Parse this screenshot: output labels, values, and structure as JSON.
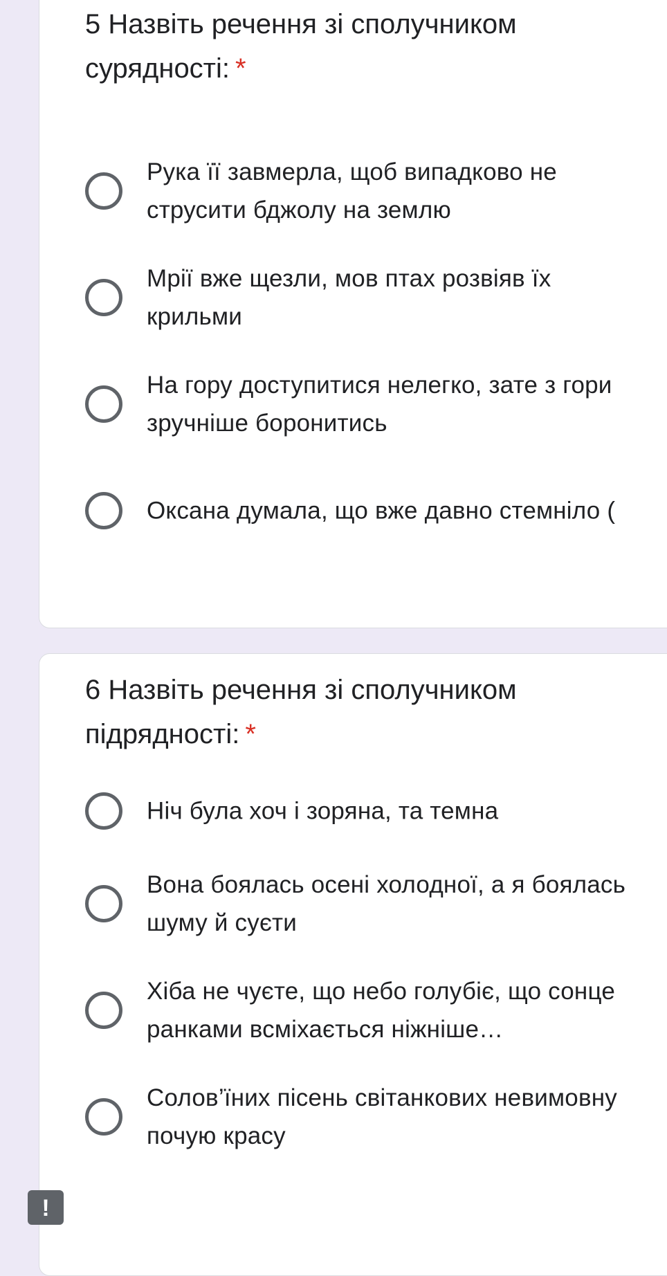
{
  "questions": [
    {
      "title": "5 Назвіть речення зі сполучником сурядності:",
      "required_mark": "*",
      "options": [
        "Рука її завмерла, щоб випадково не струсити бджолу на землю",
        "Мрії вже щезли, мов птах розвіяв їх крильми",
        "На гору доступитися нелегко, зате з гори зручніше боронитись",
        "Оксана думала, що вже давно стемніло ("
      ]
    },
    {
      "title": "6 Назвіть речення зі сполучником підрядності:",
      "required_mark": "*",
      "options": [
        "Ніч була хоч і зоряна, та темна",
        "Вона боялась осені холодної, а я боялась шуму й суєти",
        "Хіба не чуєте, що небо голубіє, що сонце ранками всміхається ніжніше…",
        "Солов’їних пісень світанкових невимовну почую красу"
      ]
    }
  ],
  "alert_badge": "!",
  "colors": {
    "background": "#ede9f6",
    "card": "#ffffff",
    "required": "#d93025",
    "radio_border": "#5f6368",
    "text": "#202124"
  }
}
